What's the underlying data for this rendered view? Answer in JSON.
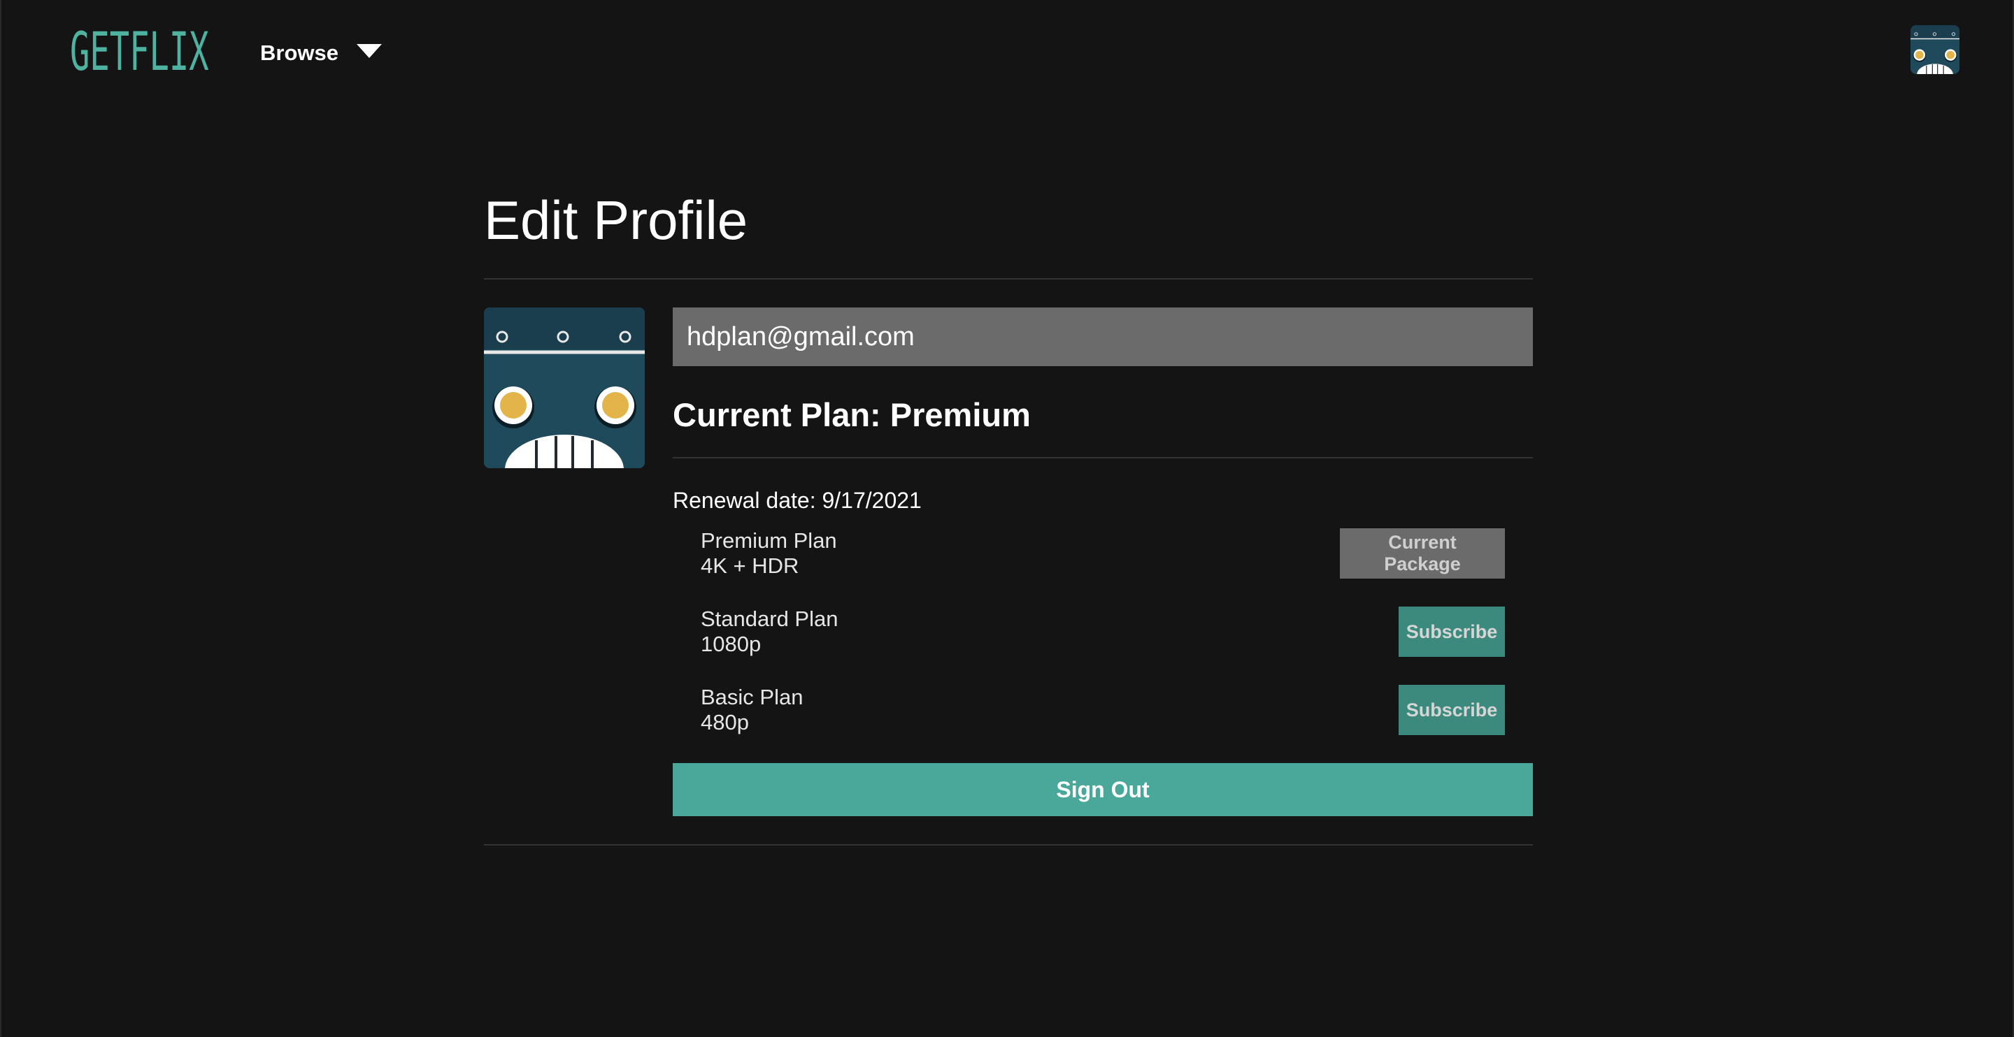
{
  "nav": {
    "logo": "GETFLIX",
    "browse_label": "Browse",
    "avatar_icon": "robot-avatar-icon"
  },
  "page": {
    "title": "Edit Profile"
  },
  "profile": {
    "avatar_icon": "robot-avatar-icon",
    "email": "hdplan@gmail.com",
    "current_plan": "Current Plan: Premium",
    "renewal": "Renewal date: 9/17/2021"
  },
  "plans": [
    {
      "name": "Premium Plan",
      "quality": "4K + HDR",
      "action": "Current Package"
    },
    {
      "name": "Standard Plan",
      "quality": "1080p",
      "action": "Subscribe"
    },
    {
      "name": "Basic Plan",
      "quality": "480p",
      "action": "Subscribe"
    }
  ],
  "signout_label": "Sign Out",
  "colors": {
    "background": "#141414",
    "brand": "#4fb2a0",
    "signout": "#4aa89b",
    "subscribe": "#3c8a7e",
    "current_package": "#6b6b6b",
    "email_field": "#6b6b6b"
  }
}
